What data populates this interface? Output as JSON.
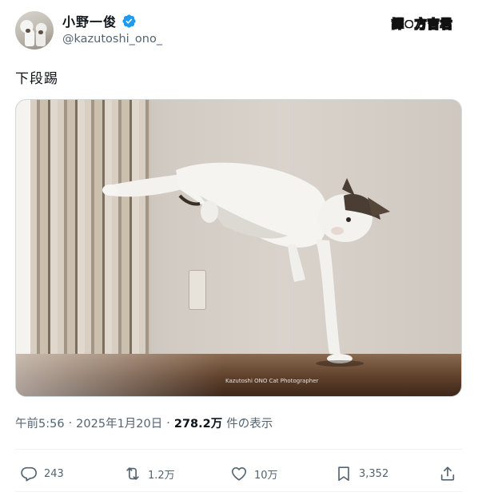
{
  "author": {
    "display_name": "小野一俊",
    "handle": "@kazutoshi_ono_",
    "verified_badge_icon": "verified-badge-icon",
    "badge_color": "#1d9bf0"
  },
  "watermark": {
    "left_text": "譯",
    "right_text": "方吉君"
  },
  "tweet": {
    "text": "下段踢"
  },
  "media": {
    "type": "photo",
    "photo_mark": "Kazutoshi ONO Cat Photographer"
  },
  "meta": {
    "time": "午前5:56",
    "separator": "·",
    "date": "2025年1月20日",
    "views_count": "278.2万",
    "views_label": "件の表示"
  },
  "actions": {
    "reply": {
      "icon": "reply-icon",
      "count": "243"
    },
    "retweet": {
      "icon": "retweet-icon",
      "count": "1.2万"
    },
    "like": {
      "icon": "heart-icon",
      "count": "10万"
    },
    "bookmark": {
      "icon": "bookmark-icon",
      "count": "3,352"
    },
    "share": {
      "icon": "share-icon"
    }
  },
  "colors": {
    "text_primary": "#0f1419",
    "text_secondary": "#536471",
    "divider": "#eff3f4"
  }
}
